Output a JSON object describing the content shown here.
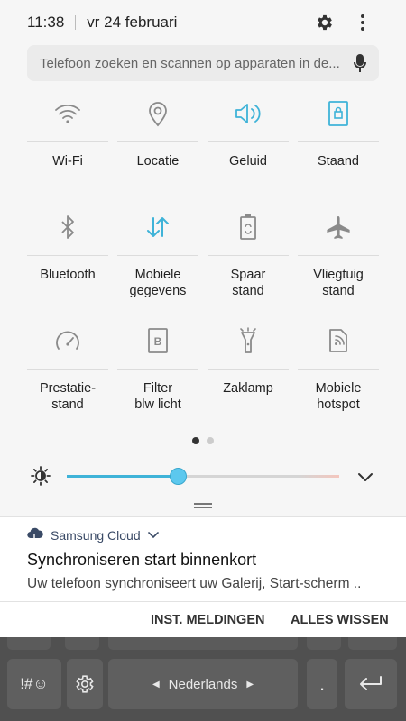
{
  "status_bar": {
    "time": "11:38",
    "date": "vr 24 februari"
  },
  "search": {
    "placeholder": "Telefoon zoeken en scannen op apparaten in de..."
  },
  "quick_settings": [
    {
      "label": "Wi-Fi",
      "icon": "wifi-icon",
      "active": false
    },
    {
      "label": "Locatie",
      "icon": "location-icon",
      "active": false
    },
    {
      "label": "Geluid",
      "icon": "sound-icon",
      "active": true
    },
    {
      "label": "Staand",
      "icon": "portrait-lock-icon",
      "active": true
    },
    {
      "label": "Bluetooth",
      "icon": "bluetooth-icon",
      "active": false
    },
    {
      "label": "Mobiele\ngegevens",
      "icon": "mobile-data-icon",
      "active": true
    },
    {
      "label": "Spaar\nstand",
      "icon": "power-saving-icon",
      "active": false
    },
    {
      "label": "Vliegtuig\nstand",
      "icon": "airplane-icon",
      "active": false
    },
    {
      "label": "Prestatie-\nstand",
      "icon": "performance-icon",
      "active": false
    },
    {
      "label": "Filter\nblw licht",
      "icon": "blue-light-filter-icon",
      "active": false
    },
    {
      "label": "Zaklamp",
      "icon": "flashlight-icon",
      "active": false
    },
    {
      "label": "Mobiele\nhotspot",
      "icon": "hotspot-icon",
      "active": false
    }
  ],
  "pager": {
    "pages": 2,
    "current": 1
  },
  "brightness": {
    "level": 0.41
  },
  "notification": {
    "app": "Samsung Cloud",
    "title": "Synchroniseren start binnenkort",
    "body": "Uw telefoon synchroniseert uw Galerij, Start-scherm .."
  },
  "actions": {
    "settings": "INST. MELDINGEN",
    "clear": "ALLES WISSEN"
  },
  "keyboard": {
    "symbols": "!#☺",
    "language": "Nederlands",
    "period": "."
  },
  "colors": {
    "accent": "#3fb3d8",
    "inactive_icon": "#8a8a8a",
    "background": "#f6f6f6"
  }
}
